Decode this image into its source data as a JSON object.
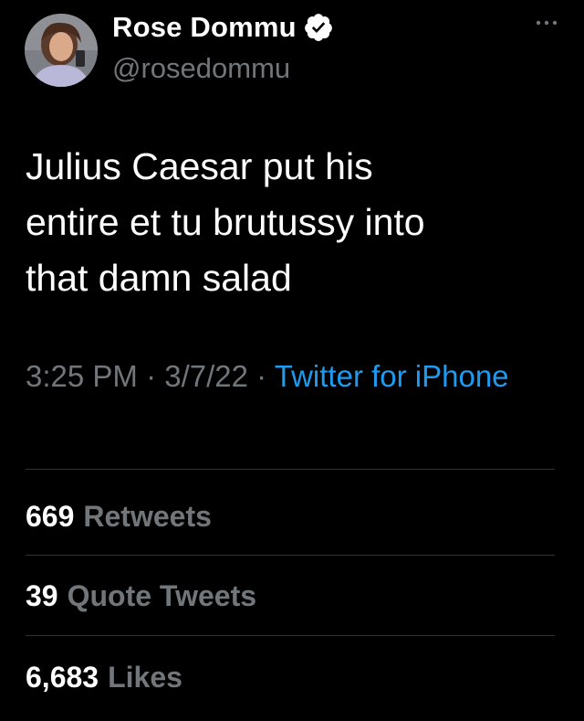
{
  "author": {
    "display_name": "Rose Dommu",
    "handle": "@rosedommu",
    "verified": true,
    "avatar_icon": "profile-photo"
  },
  "tweet": {
    "text_lines": [
      "Julius Caesar put his",
      "entire et tu brutussy into",
      "that damn salad"
    ],
    "time": "3:25 PM",
    "separator": "·",
    "date": "3/7/22",
    "source": "Twitter for iPhone"
  },
  "stats": [
    {
      "count": "669",
      "label": "Retweets"
    },
    {
      "count": "39",
      "label": "Quote Tweets"
    },
    {
      "count": "6,683",
      "label": "Likes"
    }
  ],
  "colors": {
    "background": "#000000",
    "primary_text": "#ffffff",
    "secondary_text": "#71767b",
    "link": "#1d9bf0",
    "divider": "#2f3336"
  }
}
